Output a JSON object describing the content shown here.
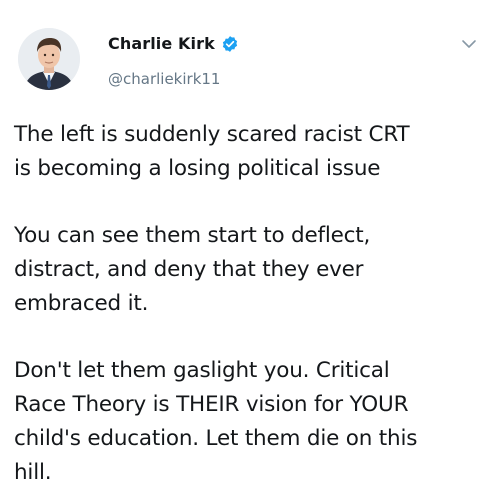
{
  "author": {
    "display_name": "Charlie Kirk",
    "handle": "@charliekirk11"
  },
  "icons": {
    "verified": "verified-badge-icon",
    "menu": "chevron-down-icon"
  },
  "colors": {
    "verified_blue": "#1da1f2",
    "handle_gray": "#657786",
    "text": "#14171a"
  },
  "tweet": {
    "paragraphs": [
      {
        "lines": [
          "The left is suddenly scared racist CRT",
          "is becoming a losing political issue"
        ]
      },
      {
        "lines": [
          "You can see them start to deflect,",
          "distract, and deny that they ever",
          "embraced it."
        ]
      },
      {
        "lines": [
          "Don't let them gaslight you. Critical",
          "Race Theory is THEIR vision for YOUR",
          "child's education. Let them die on this",
          "hill."
        ]
      }
    ]
  }
}
